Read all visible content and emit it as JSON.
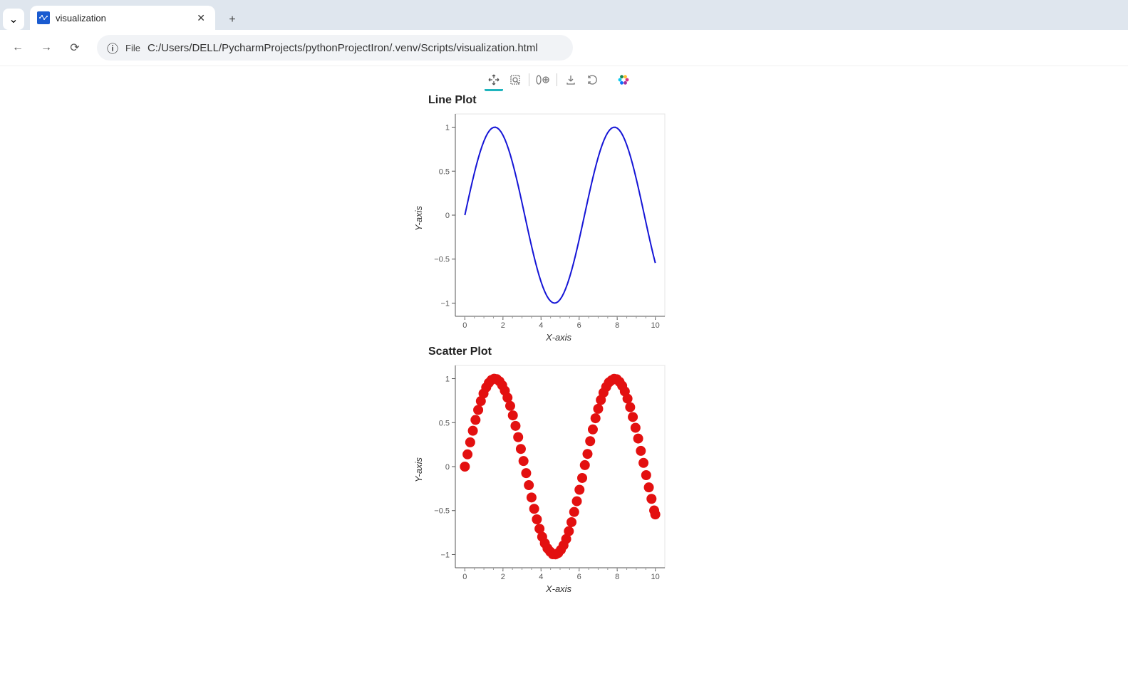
{
  "browser": {
    "tab_title": "visualization",
    "close_glyph": "✕",
    "new_tab_glyph": "+",
    "dropdown_glyph": "⌄",
    "nav": {
      "back_glyph": "←",
      "forward_glyph": "→",
      "reload_glyph": "⟳",
      "info_glyph": "ⓘ",
      "scheme_label": "File",
      "url": "C:/Users/DELL/PycharmProjects/pythonProjectIron/.venv/Scripts/visualization.html"
    }
  },
  "toolbar": {
    "tools": [
      "pan",
      "box-zoom",
      "wheel-zoom",
      "save",
      "reset"
    ],
    "logo": "bokeh"
  },
  "chart_data": [
    {
      "type": "line",
      "title": "Line Plot",
      "xlabel": "X-axis",
      "ylabel": "Y-axis",
      "x_ticks": [
        0,
        2,
        4,
        6,
        8,
        10
      ],
      "y_ticks": [
        -1,
        -0.5,
        0,
        0.5,
        1
      ],
      "xlim": [
        -0.5,
        10.5
      ],
      "ylim": [
        -1.15,
        1.15
      ],
      "color": "#1515d6",
      "x": [
        0,
        0.1,
        0.2,
        0.3,
        0.4,
        0.5,
        0.6,
        0.7,
        0.8,
        0.9,
        1,
        1.1,
        1.2,
        1.3,
        1.4,
        1.5,
        1.6,
        1.7,
        1.8,
        1.9,
        2,
        2.1,
        2.2,
        2.3,
        2.4,
        2.5,
        2.6,
        2.7,
        2.8,
        2.9,
        3,
        3.1,
        3.2,
        3.3,
        3.4,
        3.5,
        3.6,
        3.7,
        3.8,
        3.9,
        4,
        4.1,
        4.2,
        4.3,
        4.4,
        4.5,
        4.6,
        4.7,
        4.8,
        4.9,
        5,
        5.1,
        5.2,
        5.3,
        5.4,
        5.5,
        5.6,
        5.7,
        5.8,
        5.9,
        6,
        6.1,
        6.2,
        6.3,
        6.4,
        6.5,
        6.6,
        6.7,
        6.8,
        6.9,
        7,
        7.1,
        7.2,
        7.3,
        7.4,
        7.5,
        7.6,
        7.7,
        7.8,
        7.9,
        8,
        8.1,
        8.2,
        8.3,
        8.4,
        8.5,
        8.6,
        8.7,
        8.8,
        8.9,
        9,
        9.1,
        9.2,
        9.3,
        9.4,
        9.5,
        9.6,
        9.7,
        9.8,
        9.9,
        10
      ],
      "y": [
        0,
        0.0998,
        0.1987,
        0.2955,
        0.3894,
        0.4794,
        0.5646,
        0.6442,
        0.7174,
        0.7833,
        0.8415,
        0.8912,
        0.932,
        0.9636,
        0.9854,
        0.9975,
        0.9996,
        0.9917,
        0.9738,
        0.9463,
        0.9093,
        0.8632,
        0.8085,
        0.7457,
        0.6755,
        0.5985,
        0.5155,
        0.4274,
        0.335,
        0.2392,
        0.1411,
        0.0416,
        -0.0584,
        -0.1577,
        -0.2555,
        -0.3508,
        -0.4425,
        -0.5298,
        -0.6119,
        -0.6878,
        -0.7568,
        -0.8183,
        -0.8716,
        -0.9162,
        -0.9516,
        -0.9775,
        -0.9937,
        -0.9999,
        -0.9962,
        -0.9825,
        -0.9589,
        -0.9258,
        -0.8835,
        -0.8323,
        -0.7728,
        -0.7055,
        -0.6313,
        -0.5507,
        -0.4646,
        -0.3739,
        -0.2794,
        -0.1822,
        -0.0831,
        0.0168,
        0.1165,
        0.2151,
        0.3115,
        0.4048,
        0.4941,
        0.5784,
        0.657,
        0.729,
        0.7937,
        0.8504,
        0.8987,
        0.938,
        0.9679,
        0.9882,
        0.9985,
        0.9989,
        0.9894,
        0.97,
        0.9407,
        0.9022,
        0.8546,
        0.7985,
        0.7344,
        0.663,
        0.585,
        0.501,
        0.4121,
        0.3191,
        0.2229,
        0.1245,
        0.0248,
        -0.0752,
        -0.1743,
        -0.2718,
        -0.3665,
        -0.4575,
        -0.544
      ]
    },
    {
      "type": "scatter",
      "title": "Scatter Plot",
      "xlabel": "X-axis",
      "ylabel": "Y-axis",
      "x_ticks": [
        0,
        2,
        4,
        6,
        8,
        10
      ],
      "y_ticks": [
        -1,
        -0.5,
        0,
        0.5,
        1
      ],
      "xlim": [
        -0.5,
        10.5
      ],
      "ylim": [
        -1.15,
        1.15
      ],
      "color": "#e31010",
      "marker_radius": 7,
      "x": [
        0,
        0.14,
        0.28,
        0.42,
        0.56,
        0.7,
        0.84,
        0.98,
        1.12,
        1.26,
        1.4,
        1.54,
        1.68,
        1.82,
        1.96,
        2.1,
        2.24,
        2.38,
        2.52,
        2.66,
        2.8,
        2.94,
        3.08,
        3.22,
        3.36,
        3.5,
        3.64,
        3.78,
        3.92,
        4.06,
        4.2,
        4.34,
        4.48,
        4.62,
        4.76,
        4.9,
        5.04,
        5.18,
        5.32,
        5.46,
        5.6,
        5.74,
        5.88,
        6.02,
        6.16,
        6.3,
        6.44,
        6.58,
        6.72,
        6.86,
        7.0,
        7.14,
        7.28,
        7.42,
        7.56,
        7.7,
        7.84,
        7.98,
        8.12,
        8.26,
        8.4,
        8.54,
        8.68,
        8.82,
        8.96,
        9.1,
        9.24,
        9.38,
        9.52,
        9.66,
        9.8,
        9.94,
        10.0
      ],
      "y": [
        0,
        0.1395,
        0.2764,
        0.4078,
        0.5312,
        0.6442,
        0.7446,
        0.8305,
        0.9001,
        0.9521,
        0.9854,
        0.9996,
        0.994,
        0.9691,
        0.9252,
        0.8632,
        0.7843,
        0.6901,
        0.5823,
        0.463,
        0.335,
        0.2009,
        0.0636,
        -0.0743,
        -0.2108,
        -0.3508,
        -0.4799,
        -0.5992,
        -0.7062,
        -0.7984,
        -0.8716,
        -0.9299,
        -0.9668,
        -0.9966,
        -0.9979,
        -0.9825,
        -0.9463,
        -0.895,
        -0.8227,
        -0.7344,
        -0.6313,
        -0.5155,
        -0.3936,
        -0.2632,
        -0.1294,
        0.0168,
        0.1441,
        0.2896,
        0.423,
        0.5501,
        0.657,
        0.7572,
        0.8407,
        0.906,
        0.9563,
        0.9808,
        0.9985,
        0.9928,
        0.9638,
        0.919,
        0.8546,
        0.7728,
        0.6755,
        0.5643,
        0.4416,
        0.3191,
        0.179,
        0.0424,
        -0.0972,
        -0.2361,
        -0.3665,
        -0.4982,
        -0.544
      ]
    }
  ]
}
